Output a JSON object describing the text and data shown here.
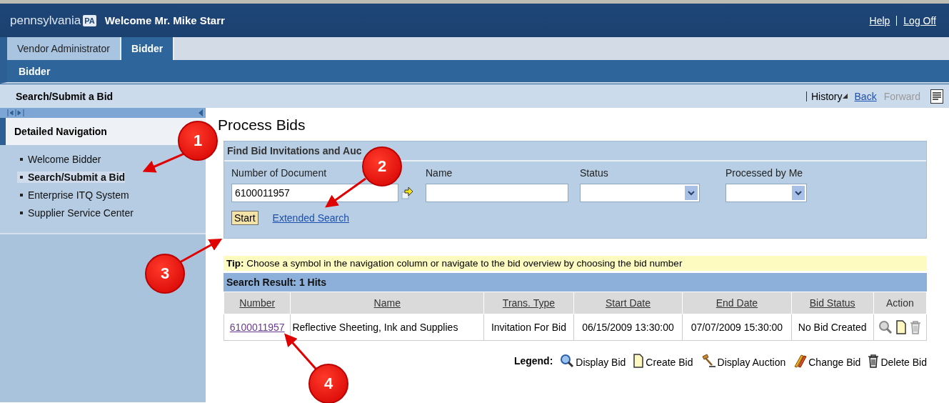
{
  "header": {
    "logo": "pennsylvania",
    "logo_badge": "PA",
    "welcome": "Welcome Mr. Mike Starr",
    "links": [
      "Help",
      "Log Off"
    ]
  },
  "tabs": [
    {
      "label": "Vendor Administrator",
      "selected": false
    },
    {
      "label": "Bidder",
      "selected": true
    }
  ],
  "subnav": {
    "label": "Bidder"
  },
  "page_bar": {
    "title": "Search/Submit a Bid",
    "history": "History",
    "links": [
      {
        "label": "Back",
        "disabled": false
      },
      {
        "label": "Forward",
        "disabled": true
      }
    ]
  },
  "sidebar": {
    "title": "Detailed Navigation",
    "items": [
      {
        "label": "Welcome Bidder",
        "selected": false
      },
      {
        "label": "Search/Submit a Bid",
        "selected": true
      },
      {
        "label": "Enterprise ITQ System",
        "selected": false
      },
      {
        "label": "Supplier Service Center",
        "selected": false
      }
    ]
  },
  "main": {
    "title": "Process Bids",
    "search": {
      "title": "Find Bid Invitations and Auc",
      "fields": [
        {
          "kind": "text",
          "label": "Number of Document",
          "value": "6100011957",
          "value_help": true
        },
        {
          "kind": "text",
          "label": "Name"
        },
        {
          "kind": "select",
          "label": "Status"
        },
        {
          "kind": "select",
          "label": "Processed by Me"
        }
      ],
      "start": "Start",
      "link": "Extended Search"
    },
    "tip": {
      "label": "Tip:",
      "text": "Choose a symbol in the navigation column or navigate to the bid overview by choosing the bid number"
    },
    "results": {
      "title": "Search Result:  1 Hits",
      "columns": [
        "Number",
        "Name",
        "Trans. Type",
        "Start Date",
        "End Date",
        "Bid Status",
        "Action"
      ],
      "rows": [
        {
          "cells": [
            "6100011957",
            "Reflective Sheeting, Ink and Supplies",
            "Invitation For Bid",
            "06/15/2009 13:30:00",
            "07/07/2009 15:30:00",
            "No Bid Created"
          ],
          "actions": [
            {
              "kind": "display",
              "disabled": true
            },
            {
              "kind": "create",
              "disabled": false
            },
            {
              "kind": "delete",
              "disabled": true
            }
          ]
        }
      ]
    },
    "legend": {
      "label": "Legend:",
      "items": [
        {
          "kind": "display",
          "label": "Display Bid"
        },
        {
          "kind": "create",
          "label": "Create Bid"
        },
        {
          "kind": "auction",
          "label": "Display Auction"
        },
        {
          "kind": "change",
          "label": "Change Bid"
        },
        {
          "kind": "delete",
          "label": "Delete Bid"
        }
      ]
    }
  },
  "callouts": [
    {
      "label": "1"
    },
    {
      "label": "2"
    },
    {
      "label": "3"
    },
    {
      "label": "4"
    }
  ]
}
